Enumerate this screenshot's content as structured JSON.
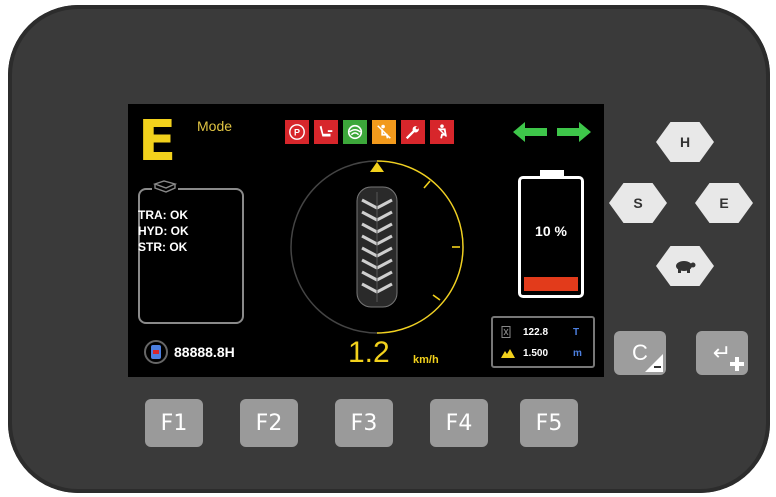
{
  "colors": {
    "accent_yellow": "#f2d11c",
    "arrow_green": "#3ec64a",
    "icon_red": "#d7262b",
    "icon_green": "#3ca73a",
    "icon_orange": "#f29a1c",
    "battery_red": "#e23b1b",
    "unit_blue": "#4c7fe0"
  },
  "screen": {
    "mode_letter": "E",
    "mode_label": "Mode",
    "status_icons": [
      {
        "name": "parking-brake-icon",
        "glyph": "P",
        "color": "#d7262b"
      },
      {
        "name": "seat-icon",
        "glyph": "seat",
        "color": "#d7262b"
      },
      {
        "name": "steering-icon",
        "glyph": "steer",
        "color": "#3ca73a"
      },
      {
        "name": "operator-absent-icon",
        "glyph": "x",
        "color": "#f29a1c"
      },
      {
        "name": "maintenance-wrench-icon",
        "glyph": "wrench",
        "color": "#d7262b"
      },
      {
        "name": "seatbelt-icon",
        "glyph": "belt",
        "color": "#d7262b"
      }
    ],
    "direction_icon": "double-arrow-left-right",
    "diagnostics": [
      "TRA: OK",
      "HYD: OK",
      "STR: OK"
    ],
    "hour_meter": "88888.8H",
    "speed_value": "1.2",
    "speed_unit": "km/h",
    "battery_percent_label": "10 %",
    "battery_level": 0.1,
    "load_value": "122.8",
    "load_unit": "T",
    "height_value": "1.500",
    "height_unit": "m"
  },
  "nav_buttons": {
    "up": "H",
    "left": "S",
    "right": "E",
    "down_icon": "turtle-icon"
  },
  "action_buttons": {
    "cancel": "C",
    "enter": "↵"
  },
  "function_keys": [
    "F1",
    "F2",
    "F3",
    "F4",
    "F5"
  ]
}
